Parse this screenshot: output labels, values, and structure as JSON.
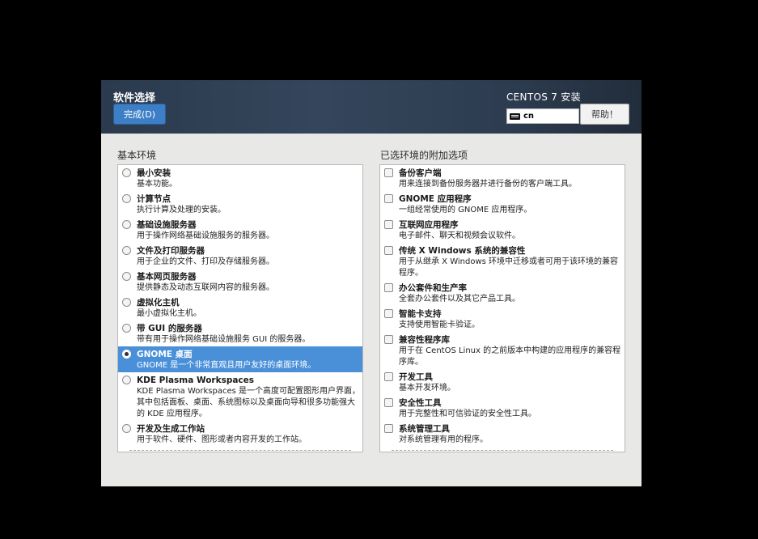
{
  "header": {
    "title": "软件选择",
    "done_label": "完成(D)",
    "product": "CENTOS 7 安装",
    "keyboard_layout": "cn",
    "help_label": "帮助！"
  },
  "base": {
    "heading": "基本环境",
    "items": [
      {
        "name": "最小安装",
        "desc": "基本功能。",
        "selected": false
      },
      {
        "name": "计算节点",
        "desc": "执行计算及处理的安装。",
        "selected": false
      },
      {
        "name": "基础设施服务器",
        "desc": "用于操作网络基础设施服务的服务器。",
        "selected": false
      },
      {
        "name": "文件及打印服务器",
        "desc": "用于企业的文件、打印及存储服务器。",
        "selected": false
      },
      {
        "name": "基本网页服务器",
        "desc": "提供静态及动态互联网内容的服务器。",
        "selected": false
      },
      {
        "name": "虚拟化主机",
        "desc": "最小虚拟化主机。",
        "selected": false
      },
      {
        "name": "带 GUI 的服务器",
        "desc": "带有用于操作网络基础设施服务 GUI 的服务器。",
        "selected": false
      },
      {
        "name": "GNOME 桌面",
        "desc": "GNOME 是一个非常直观且用户友好的桌面环境。",
        "selected": true
      },
      {
        "name": "KDE Plasma Workspaces",
        "desc": "KDE Plasma Workspaces 是一个高度可配置图形用户界面，其中包括面板、桌面、系统图标以及桌面向导和很多功能强大的 KDE 应用程序。",
        "selected": false
      },
      {
        "name": "开发及生成工作站",
        "desc": "用于软件、硬件、图形或者内容开发的工作站。",
        "selected": false
      }
    ]
  },
  "addons": {
    "heading": "已选环境的附加选项",
    "items": [
      {
        "name": "备份客户端",
        "desc": "用来连接到备份服务器并进行备份的客户端工具。",
        "checked": false
      },
      {
        "name": "GNOME 应用程序",
        "desc": "一组经常使用的 GNOME 应用程序。",
        "checked": false
      },
      {
        "name": "互联网应用程序",
        "desc": "电子邮件、聊天和视频会议软件。",
        "checked": false
      },
      {
        "name": "传统 X Windows 系统的兼容性",
        "desc": "用于从继承 X Windows 环境中迁移或者可用于该环境的兼容程序。",
        "checked": false
      },
      {
        "name": "办公套件和生产率",
        "desc": "全套办公套件以及其它产品工具。",
        "checked": false
      },
      {
        "name": "智能卡支持",
        "desc": "支持使用智能卡验证。",
        "checked": false
      },
      {
        "name": "兼容性程序库",
        "desc": "用于在 CentOS Linux 的之前版本中构建的应用程序的兼容程序库。",
        "checked": false
      },
      {
        "name": "开发工具",
        "desc": "基本开发环境。",
        "checked": false
      },
      {
        "name": "安全性工具",
        "desc": "用于完整性和可信验证的安全性工具。",
        "checked": false
      },
      {
        "name": "系统管理工具",
        "desc": "对系统管理有用的程序。",
        "checked": false
      }
    ]
  }
}
